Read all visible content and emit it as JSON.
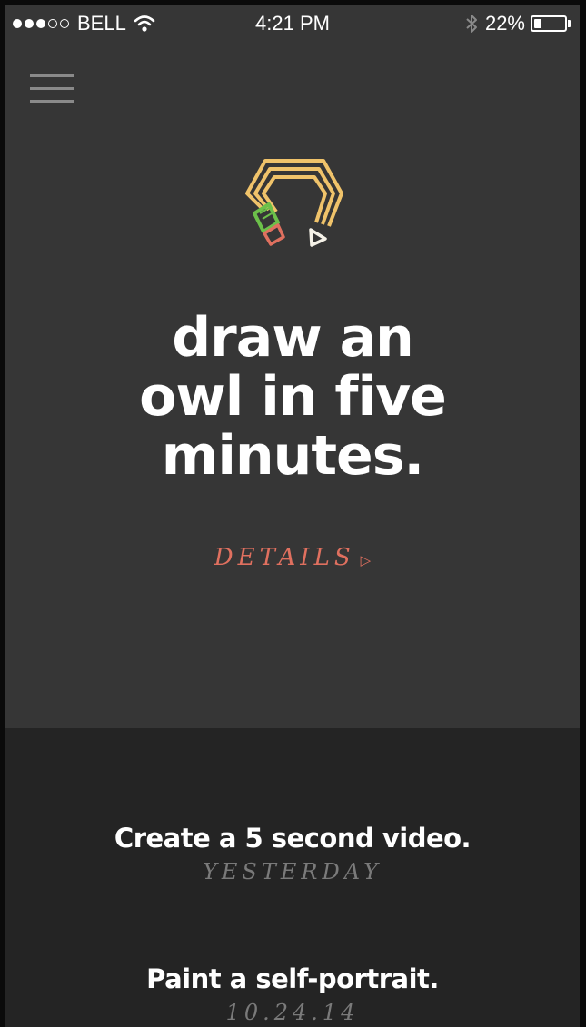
{
  "status_bar": {
    "signal_filled": 3,
    "signal_total": 5,
    "carrier": "BELL",
    "time": "4:21 PM",
    "battery_percent": "22%",
    "battery_level": 0.22,
    "icons": [
      "wifi-icon",
      "bluetooth-icon",
      "battery-icon"
    ]
  },
  "header": {
    "menu_icon": "hamburger-menu-icon"
  },
  "logo": {
    "icon": "pencil-hexagon-logo"
  },
  "challenge": {
    "headline_lines": [
      "draw an",
      "owl in five",
      "minutes."
    ],
    "details_label": "DETAILS",
    "details_arrow": "▷"
  },
  "history": [
    {
      "title": "Create a 5 second video.",
      "date": "YESTERDAY"
    },
    {
      "title": "Paint a self-portrait.",
      "date": "10.24.14"
    }
  ],
  "colors": {
    "background": "#363636",
    "history_background": "#242424",
    "accent": "#e0705f",
    "logo_yellow": "#f0c36a",
    "logo_green": "#6cc04a",
    "logo_red": "#e0705f"
  }
}
